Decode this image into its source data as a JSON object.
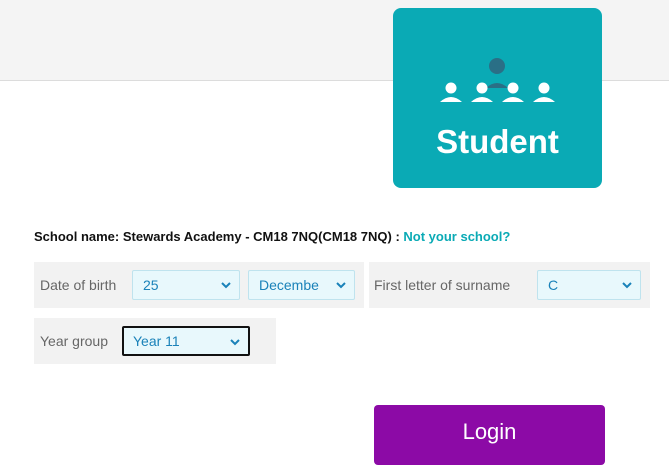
{
  "student_card": {
    "label": "Student",
    "icon": "students-group-icon",
    "color": "#0aaab5"
  },
  "school": {
    "prefix": "School name: Stewards Academy - CM18 7NQ(CM18 7NQ) :",
    "not_your_school": "Not your school?"
  },
  "form": {
    "dob_label": "Date of birth",
    "dob_day": "25",
    "dob_month": "Decembe",
    "surname_label": "First letter of surname",
    "surname_letter": "C",
    "year_label": "Year group",
    "year_value": "Year 11"
  },
  "login_label": "Login",
  "colors": {
    "accent": "#0aaab5",
    "login": "#8c0aa6",
    "select_text": "#1a82b9"
  }
}
